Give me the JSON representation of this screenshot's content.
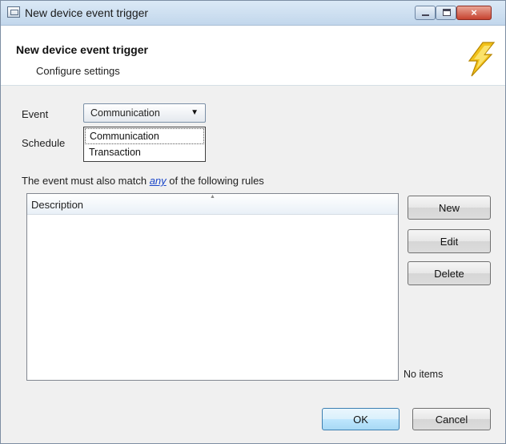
{
  "window": {
    "title": "New device event trigger",
    "controls": {
      "minimize": "minimize",
      "maximize": "maximize",
      "close": "×"
    }
  },
  "header": {
    "title": "New device event trigger",
    "subtitle": "Configure settings",
    "icon": "lightning-bolt-icon"
  },
  "form": {
    "event_label": "Event",
    "event_value": "Communication",
    "schedule_label": "Schedule",
    "event_options": [
      "Communication",
      "Transaction"
    ]
  },
  "rules": {
    "prefix": "The event must also match",
    "link": "any",
    "suffix": "of the following rules",
    "column_header": "Description",
    "status": "No items"
  },
  "buttons": {
    "new": "New",
    "edit": "Edit",
    "delete": "Delete",
    "ok": "OK",
    "cancel": "Cancel"
  },
  "colors": {
    "link": "#1a46c9",
    "close_button": "#c6432f",
    "bolt": "#f2c21a"
  }
}
